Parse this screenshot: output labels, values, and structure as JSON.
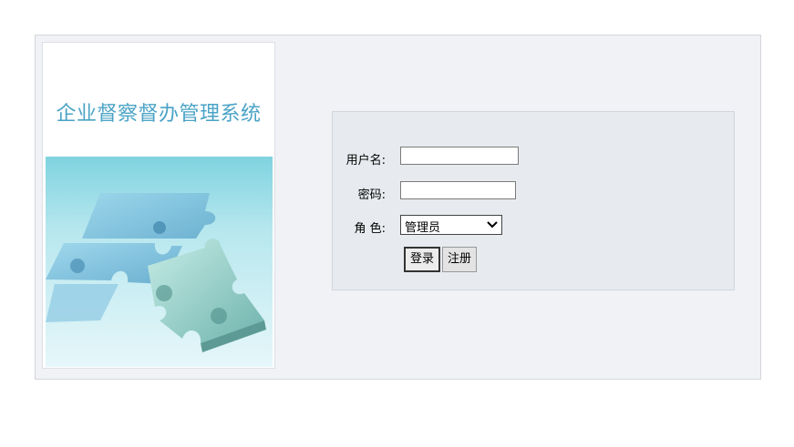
{
  "system": {
    "title": "企业督察督办管理系统"
  },
  "login": {
    "username_label": "用户名:",
    "username_value": "",
    "password_label": "密码:",
    "password_value": "",
    "role_label": "角 色:",
    "role_selected": "管理员",
    "login_button": "登录",
    "register_button": "注册"
  },
  "colors": {
    "title": "#4aa3c6",
    "panel_bg": "#f1f2f6",
    "login_bg": "#e7ebef"
  },
  "icons": {
    "role_dropdown": "chevron-down-icon",
    "illustration": "puzzle-illustration"
  }
}
